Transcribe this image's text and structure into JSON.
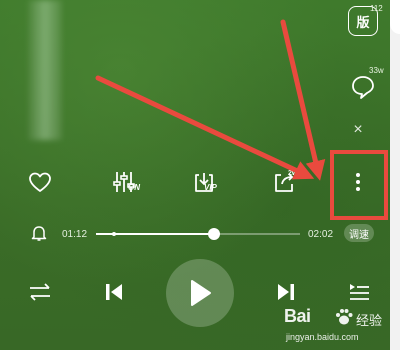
{
  "side": {
    "version_glyph": "版",
    "version_count": "112",
    "comment_count": "33w",
    "close_glyph": "×"
  },
  "actions": {
    "eq_sub": "ON",
    "download_sub": "VIP",
    "share_count": "2w"
  },
  "progress": {
    "current_time": "01:12",
    "total_time": "02:02",
    "fraction": 0.58,
    "adjust_label": "调速"
  },
  "watermark": {
    "brand": "Bai",
    "brand_suffix": "经验",
    "url": "jingyan.baidu.com"
  },
  "colors": {
    "background": "#3d6e29",
    "annotation": "#e94a3e",
    "foreground": "#ffffff"
  }
}
